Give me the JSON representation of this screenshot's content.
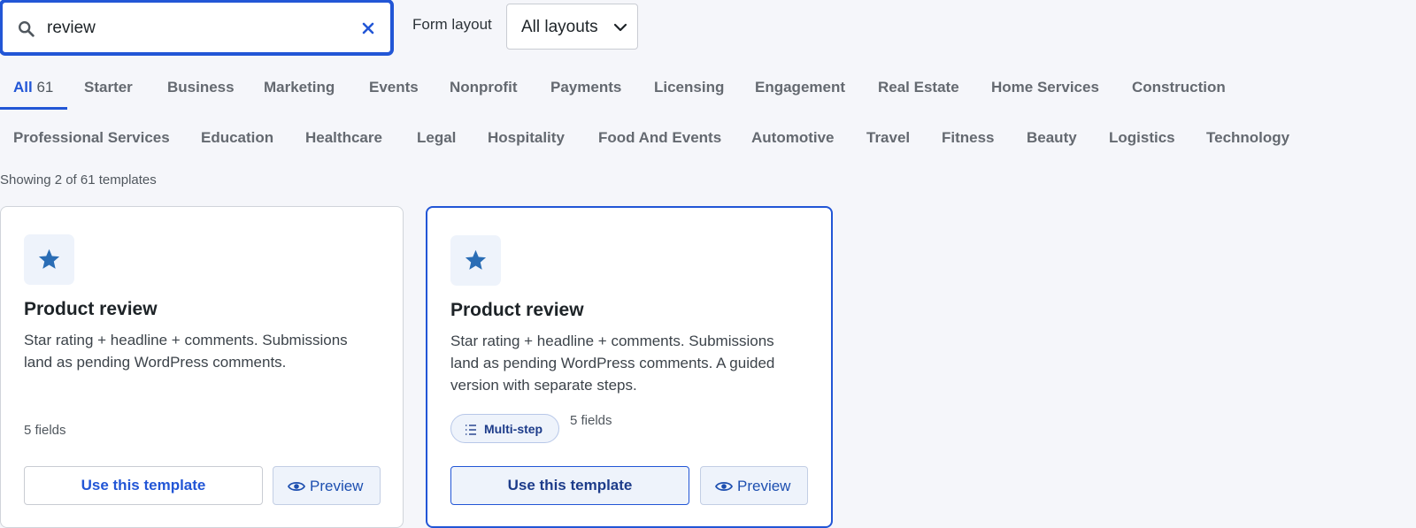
{
  "search": {
    "value": "review"
  },
  "layout": {
    "label": "Form layout",
    "selected": "All layouts"
  },
  "tabs_row1": [
    {
      "label": "All",
      "count": "61",
      "active": true
    },
    {
      "label": "Starter"
    },
    {
      "label": "Business"
    },
    {
      "label": "Marketing"
    },
    {
      "label": "Events"
    },
    {
      "label": "Nonprofit"
    },
    {
      "label": "Payments"
    },
    {
      "label": "Licensing"
    },
    {
      "label": "Engagement"
    },
    {
      "label": "Real Estate"
    },
    {
      "label": "Home Services"
    },
    {
      "label": "Construction"
    }
  ],
  "tabs_row2": [
    {
      "label": "Professional Services"
    },
    {
      "label": "Education"
    },
    {
      "label": "Healthcare"
    },
    {
      "label": "Legal"
    },
    {
      "label": "Hospitality"
    },
    {
      "label": "Food And Events"
    },
    {
      "label": "Automotive"
    },
    {
      "label": "Travel"
    },
    {
      "label": "Fitness"
    },
    {
      "label": "Beauty"
    },
    {
      "label": "Logistics"
    },
    {
      "label": "Technology"
    }
  ],
  "results": {
    "showing": "Showing 2 of 61 templates"
  },
  "cards": [
    {
      "icon": "star-icon",
      "title": "Product review",
      "description": "Star rating + headline + comments. Submissions land as pending WordPress comments.",
      "fields": "5 fields",
      "use_label": "Use this template",
      "preview_label": "Preview"
    },
    {
      "icon": "star-icon",
      "title": "Product review",
      "description": "Star rating + headline + comments. Submissions land as pending WordPress comments. A guided version with separate steps.",
      "badge": "Multi-step",
      "fields": "5 fields",
      "use_label": "Use this template",
      "preview_label": "Preview"
    }
  ],
  "colors": {
    "accent": "#2256d6",
    "icon_blue": "#2a6db5",
    "background": "#f5f6fa"
  }
}
